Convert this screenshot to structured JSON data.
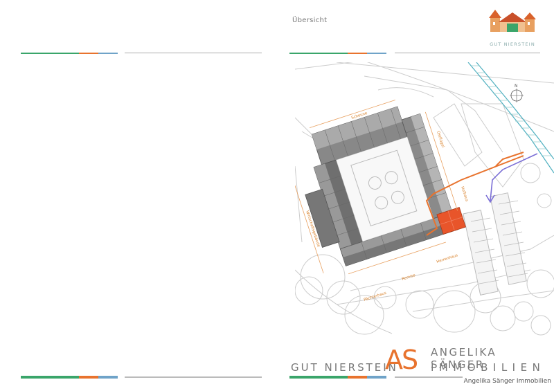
{
  "right_page": {
    "section_title": "Übersicht",
    "logo": {
      "name": "GUT NIERSTEIN"
    },
    "plan": {
      "labels": {
        "scheune": "Scheune",
        "ostflugel": "Ostflügel",
        "wirtschaft": "Wirtschaftsgebäude",
        "hofhaus": "Hofhaus",
        "remise": "Remise",
        "herrenhaus": "Herrenhaus",
        "parkhaus": "Pächterhaus",
        "nord": "N"
      }
    },
    "footer": {
      "gut_nierstein": "GUT NIERSTEIN",
      "as_mark": "AS",
      "name_line1": "ANGELIKA SÄNGER",
      "name_line2": "IMMOBILIEN"
    }
  },
  "credit": "Angelika Sänger Immobilien",
  "colors": {
    "line_green": "#3aa56a",
    "line_orange": "#e8732e",
    "line_blue": "#6fa3c8",
    "line_gray": "#999999",
    "accent_orange": "#e8732e",
    "path_purple": "#7b6fd6",
    "text_gray": "#777777"
  }
}
